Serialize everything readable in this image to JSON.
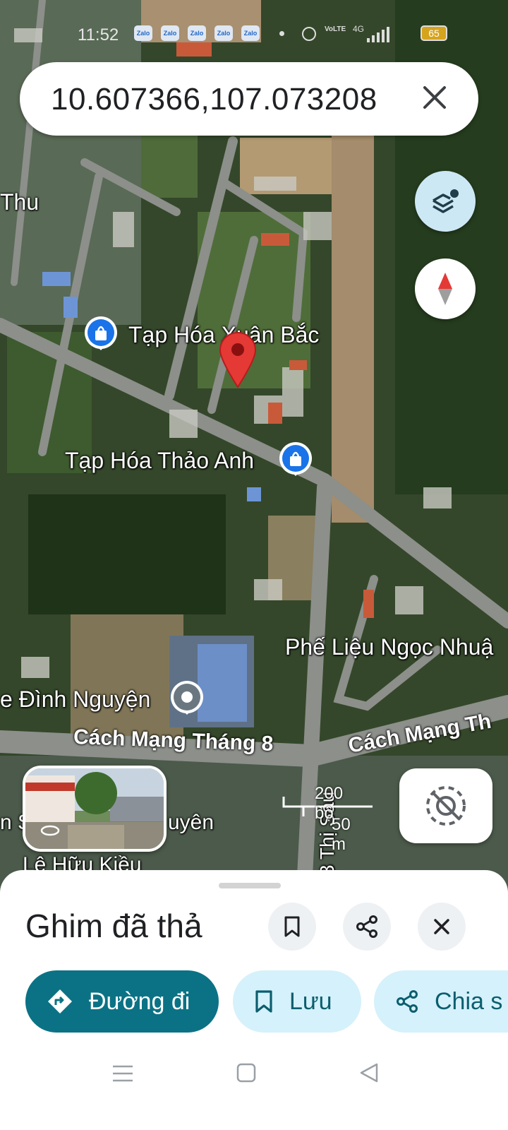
{
  "status_bar": {
    "time": "11:52",
    "notif_apps": [
      "Zalo",
      "Zalo",
      "Zalo",
      "Zalo",
      "Zalo"
    ],
    "network": "4G",
    "volte": "VoLTE",
    "battery": "65"
  },
  "search": {
    "query": "10.607366,107.073208"
  },
  "map": {
    "labels": {
      "street_thu": "Thu",
      "poi_1": "Tạp Hóa Xuân Bắc",
      "poi_2": "Tạp Hóa Thảo Anh",
      "poi_3": "Phế Liệu Ngọc Nhuậ",
      "poi_4": "e Đình Nguyện",
      "road_1": "Cách Mạng Tháng 8",
      "road_2": "Cách Mạng Th",
      "street_bottom_left": "n S",
      "street_bottom_mid": "uyên",
      "street_le": "Lê Hữu Kiều",
      "street_vertical": "3 Thị Sáu"
    },
    "scale": {
      "imperial": "200 bộ",
      "metric": "50 m"
    }
  },
  "sheet": {
    "title": "Ghim đã thả",
    "actions": {
      "directions": "Đường đi",
      "save": "Lưu",
      "share": "Chia s"
    }
  },
  "colors": {
    "accent": "#0b7285",
    "chip": "#d5f1fb",
    "pin": "#e53935",
    "poi": "#1a73e8"
  }
}
